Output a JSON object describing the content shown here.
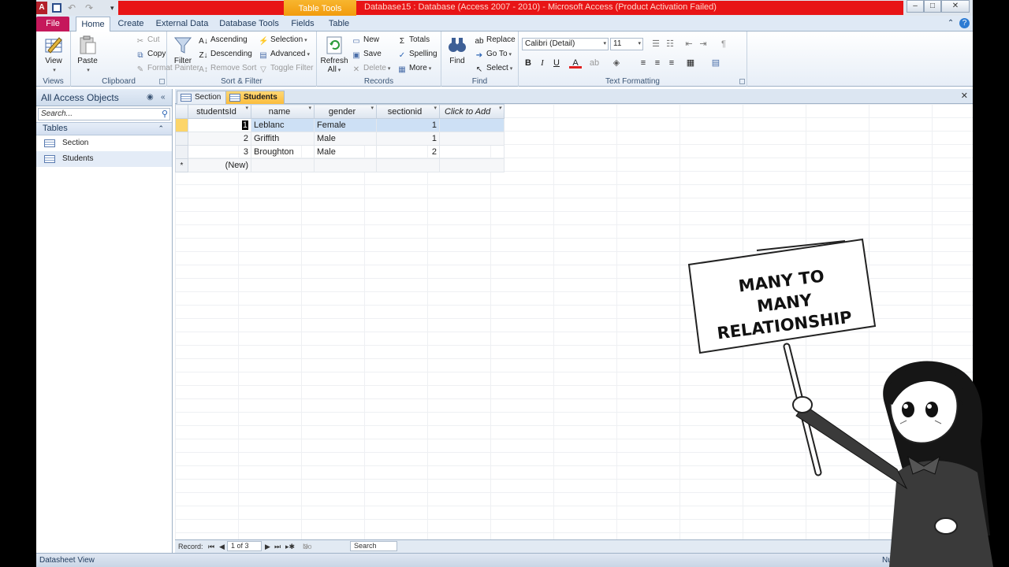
{
  "title_bar": {
    "app_icon_letter": "A",
    "contextual_tab": "Table Tools",
    "window_title": "Database15 : Database (Access 2007 - 2010)  -  Microsoft Access (Product Activation Failed)"
  },
  "ribbon_tabs": [
    "File",
    "Home",
    "Create",
    "External Data",
    "Database Tools",
    "Fields",
    "Table"
  ],
  "ribbon": {
    "views": {
      "label": "Views",
      "view": "View"
    },
    "clipboard": {
      "label": "Clipboard",
      "paste": "Paste",
      "cut": "Cut",
      "copy": "Copy",
      "format_painter": "Format Painter"
    },
    "sort_filter": {
      "label": "Sort & Filter",
      "filter": "Filter",
      "ascending": "Ascending",
      "descending": "Descending",
      "remove_sort": "Remove Sort",
      "selection": "Selection",
      "advanced": "Advanced",
      "toggle_filter": "Toggle Filter"
    },
    "records": {
      "label": "Records",
      "refresh": "Refresh",
      "refresh_sub": "All",
      "new": "New",
      "save": "Save",
      "delete": "Delete",
      "totals": "Totals",
      "spelling": "Spelling",
      "more": "More"
    },
    "find": {
      "label": "Find",
      "find": "Find",
      "replace": "Replace",
      "goto": "Go To",
      "select": "Select"
    },
    "text_formatting": {
      "label": "Text Formatting",
      "font": "Calibri (Detail)",
      "size": "11",
      "bold": "B",
      "italic": "I",
      "underline": "U"
    }
  },
  "nav_pane": {
    "header": "All Access Objects",
    "search_placeholder": "Search...",
    "section": "Tables",
    "items": [
      {
        "label": "Section"
      },
      {
        "label": "Students"
      }
    ]
  },
  "doc_tabs": [
    {
      "label": "Section"
    },
    {
      "label": "Students"
    }
  ],
  "datasheet": {
    "columns": [
      "studentsId",
      "name",
      "gender",
      "sectionid",
      "Click to Add"
    ],
    "rows": [
      {
        "id": "1",
        "name": "Leblanc",
        "gender": "Female",
        "sectionid": "1"
      },
      {
        "id": "2",
        "name": "Griffith",
        "gender": "Male",
        "sectionid": "1"
      },
      {
        "id": "3",
        "name": "Broughton",
        "gender": "Male",
        "sectionid": "2"
      }
    ],
    "new_row_marker": "*",
    "new_row_label": "(New)"
  },
  "record_nav": {
    "label": "Record:",
    "position": "1 of 3",
    "filter": "No Filter",
    "search": "Search"
  },
  "status_bar": {
    "left": "Datasheet View",
    "right": "Num Lo"
  },
  "overlay": {
    "sign_line1": "MANY TO",
    "sign_line2": "MANY",
    "sign_line3": "RELATIONSHIP"
  },
  "colors": {
    "title_red": "#e81416",
    "file_tab": "#c5185b",
    "context_tab": "#f29b0d",
    "selection": "#cde0f5"
  }
}
